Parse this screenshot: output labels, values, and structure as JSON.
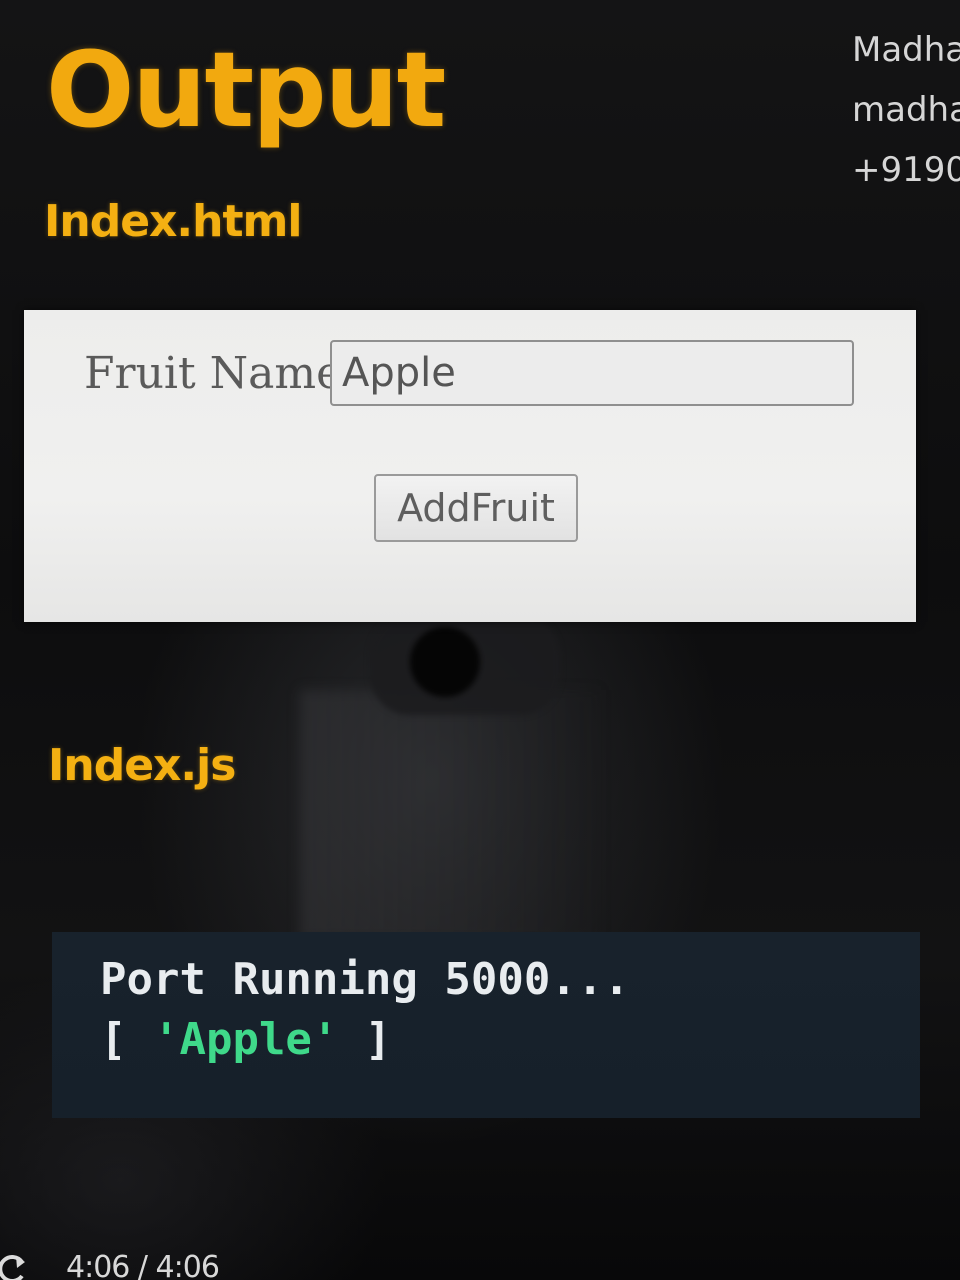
{
  "header": {
    "title": "Output",
    "contact_lines": [
      "Madha",
      "madha",
      "+9190"
    ]
  },
  "sections": {
    "html_label": "Index.html",
    "js_label": "Index.js"
  },
  "form": {
    "fruit_label": "Fruit Name",
    "fruit_value": "Apple",
    "submit_label": "AddFruit"
  },
  "terminal": {
    "line1": "Port Running 5000...",
    "line2_open": "[ ",
    "line2_string": "'Apple'",
    "line2_close": " ]"
  },
  "player": {
    "time": "4:06 / 4:06",
    "replay_icon": "replay-icon"
  },
  "colors": {
    "accent": "#f2a90f",
    "terminal_bg": "#18222c",
    "string_green": "#3fd98a"
  }
}
